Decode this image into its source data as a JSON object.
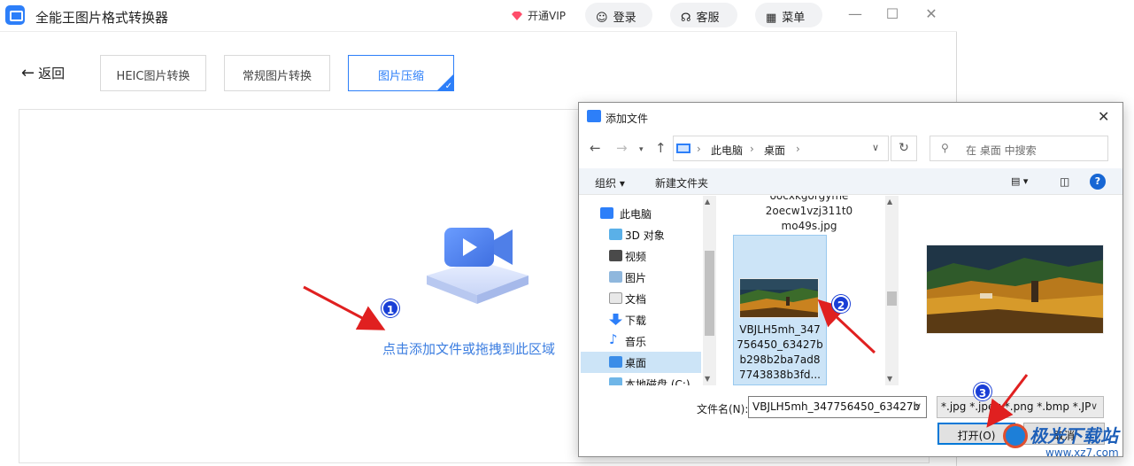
{
  "app": {
    "title": "全能王图片格式转换器",
    "vip": "开通VIP",
    "login": "登录",
    "service": "客服",
    "menu": "菜单"
  },
  "nav": {
    "back": "返回",
    "tabs": [
      {
        "label": "HEIC图片转换",
        "active": false
      },
      {
        "label": "常规图片转换",
        "active": false
      },
      {
        "label": "图片压缩",
        "active": true
      }
    ]
  },
  "dropzone": {
    "text": "点击添加文件或拖拽到此区域"
  },
  "markers": [
    "1",
    "2",
    "3"
  ],
  "dialog": {
    "title": "添加文件",
    "breadcrumb": [
      "此电脑",
      "桌面"
    ],
    "search_placeholder": "在 桌面 中搜索",
    "toolbar": {
      "organize": "组织",
      "new_folder": "新建文件夹"
    },
    "sidebar": [
      {
        "label": "此电脑",
        "icon": "computer-icon",
        "selected": false
      },
      {
        "label": "3D 对象",
        "icon": "cube-icon",
        "selected": false
      },
      {
        "label": "视频",
        "icon": "video-icon",
        "selected": false
      },
      {
        "label": "图片",
        "icon": "picture-icon",
        "selected": false
      },
      {
        "label": "文档",
        "icon": "document-icon",
        "selected": false
      },
      {
        "label": "下载",
        "icon": "download-icon",
        "selected": false
      },
      {
        "label": "音乐",
        "icon": "music-icon",
        "selected": false
      },
      {
        "label": "桌面",
        "icon": "desktop-icon",
        "selected": true
      },
      {
        "label": "本地磁盘 (C:)",
        "icon": "drive-icon",
        "selected": false
      }
    ],
    "files": {
      "top_name_lines": [
        "oocxkgorgyme",
        "2oecw1vzj311t0",
        "mo49s.jpg"
      ],
      "selected_name_lines": [
        "VBJLH5mh_347",
        "756450_63427b",
        "b298b2ba7ad8",
        "7743838b3fd..."
      ]
    },
    "filename_label": "文件名(N):",
    "filename_value": "VBJLH5mh_347756450_63427b",
    "filter_value": "*.jpg *.jpeg *.png *.bmp *.JP",
    "open_label": "打开(O)",
    "cancel_label": "取消"
  },
  "watermark": {
    "name": "极光下载站",
    "url": "www.xz7.com"
  },
  "colors": {
    "accent": "#2d7ff9",
    "link": "#3b7de0",
    "marker": "#1a3fd6",
    "arrow": "#e02020"
  }
}
